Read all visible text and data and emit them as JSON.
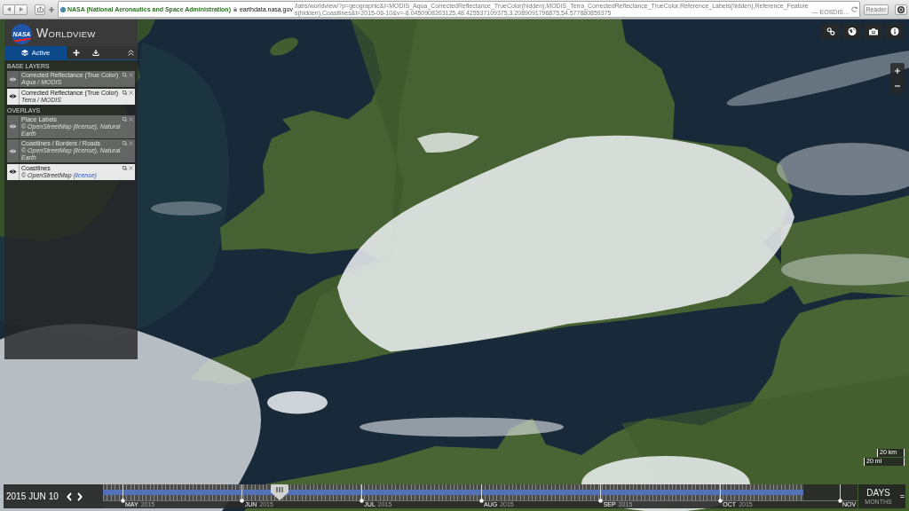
{
  "browser": {
    "site_identity": "NASA (National Aeronautics and Space Administration)",
    "address": {
      "domain": "earthdata.nasa.gov",
      "path": "/labs/worldview/?p=geographic&l=MODIS_Aqua_CorrectedReflectance_TrueColor(hidden),MODIS_Terra_CorrectedReflectance_TrueColor,Reference_Labels(hidden),Reference_Features(hidden),Coastlines&t=2015-06-10&v=-8.0450908203125,48.425537109375,3.2089091796875,54.577880859375",
      "page_title": "— EOSDIS…"
    },
    "reader_button": "Reader"
  },
  "app": {
    "logo": "NASA",
    "title": "WORLDVIEW"
  },
  "sidebar": {
    "tabs": [
      {
        "kind": "layers",
        "label": "Active",
        "selected": true
      },
      {
        "kind": "add",
        "selected": false
      },
      {
        "kind": "download",
        "selected": false
      }
    ],
    "groups": [
      {
        "heading": "BASE LAYERS",
        "layers": [
          {
            "title": "Corrected Reflectance (True Color)",
            "subtitle": [
              {
                "kind": "text",
                "text": "Aqua / MODIS"
              }
            ],
            "visible": false
          },
          {
            "title": "Corrected Reflectance (True Color)",
            "subtitle": [
              {
                "kind": "text",
                "text": "Terra / MODIS"
              }
            ],
            "visible": true
          }
        ]
      },
      {
        "heading": "OVERLAYS",
        "layers": [
          {
            "title": "Place Labels",
            "subtitle": [
              {
                "kind": "text",
                "text": "© OpenStreetMap "
              },
              {
                "kind": "link",
                "text": "(license)"
              },
              {
                "kind": "text",
                "text": ", Natural Earth"
              }
            ],
            "visible": false
          },
          {
            "title": "Coastlines / Borders / Roads",
            "subtitle": [
              {
                "kind": "text",
                "text": "© OpenStreetMap "
              },
              {
                "kind": "link",
                "text": "(license)"
              },
              {
                "kind": "text",
                "text": ", Natural Earth"
              }
            ],
            "visible": false
          },
          {
            "title": "Coastlines",
            "subtitle": [
              {
                "kind": "text",
                "text": "© OpenStreetMap "
              },
              {
                "kind": "link",
                "text": "(license)"
              }
            ],
            "visible": true
          }
        ]
      }
    ]
  },
  "scale_bar": {
    "metric": "20 km",
    "imperial": "20 mi"
  },
  "timeline": {
    "date": {
      "year": "2015",
      "month": "JUN",
      "day": "10"
    },
    "level": 0.234,
    "coverage": {
      "level": 0.928
    },
    "months": [
      {
        "label": "MAY",
        "year": "2015"
      },
      {
        "label": "JUN",
        "year": "2015"
      },
      {
        "label": "JUL",
        "year": "2015"
      },
      {
        "label": "AUG",
        "year": "2015"
      },
      {
        "label": "SEP",
        "year": "2015"
      },
      {
        "label": "OCT",
        "year": "2015"
      },
      {
        "label": "NOV"
      }
    ],
    "zoom_levels": [
      {
        "label": "DAYS",
        "selected": true
      },
      {
        "label": "MONTHS",
        "selected": false
      }
    ]
  }
}
